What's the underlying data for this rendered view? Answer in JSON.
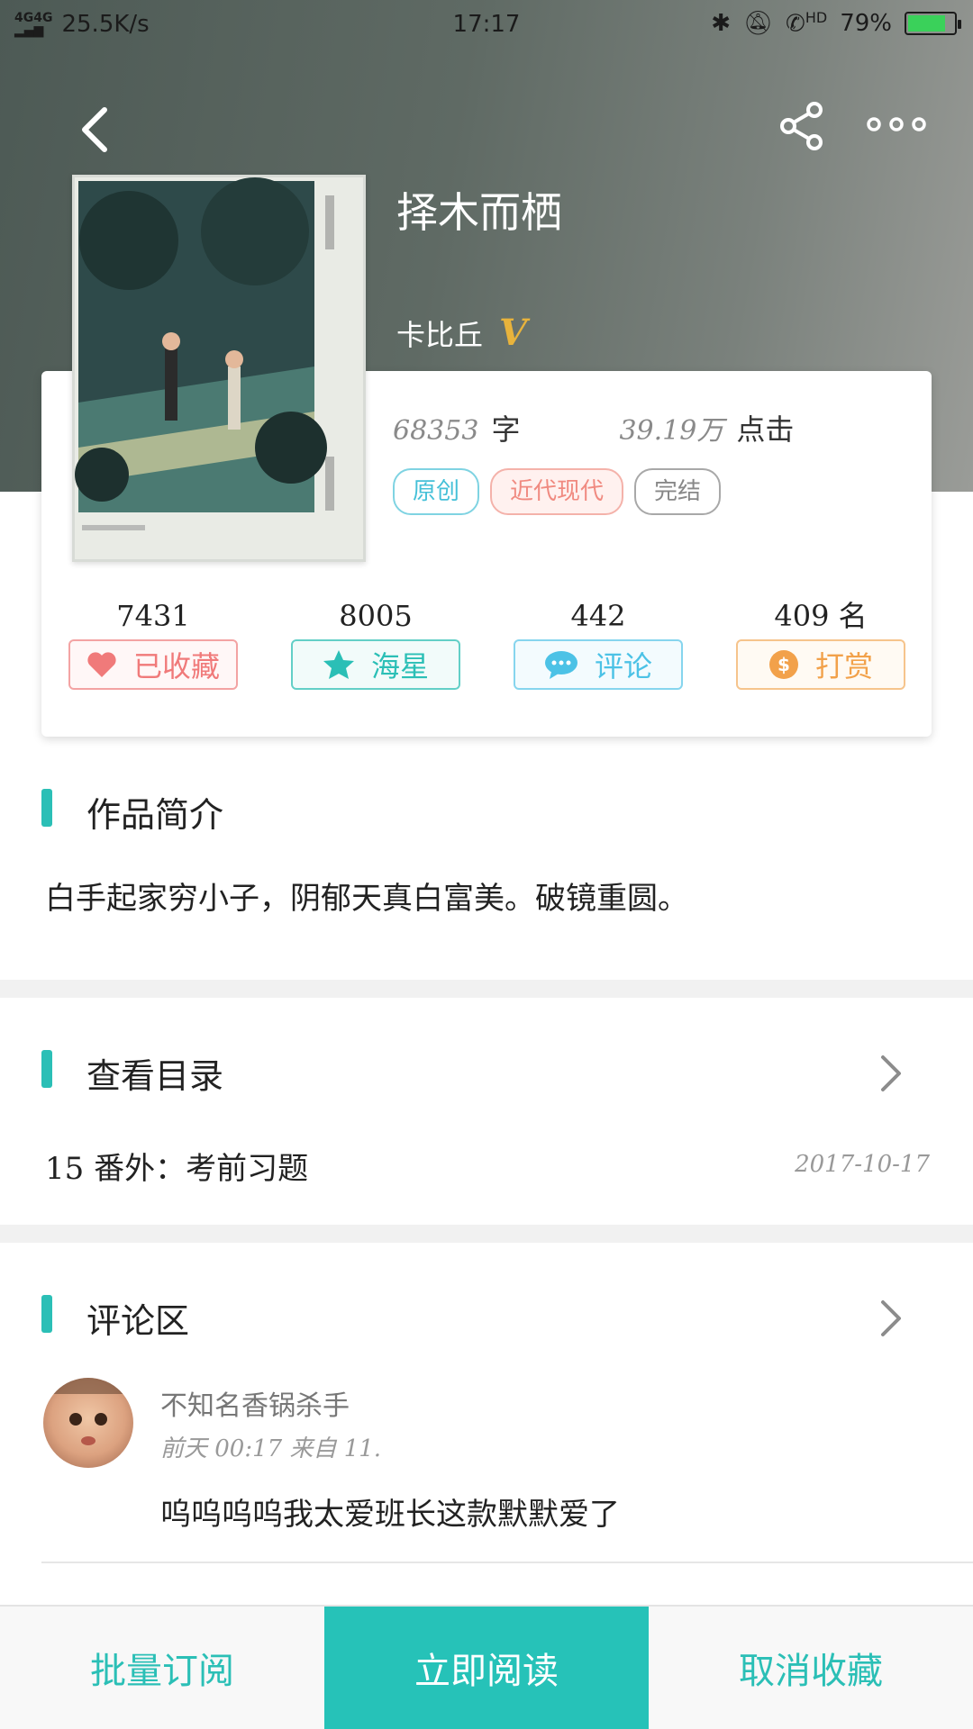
{
  "status_bar": {
    "network": "4G 4G",
    "speed": "25.5K/s",
    "time": "17:17",
    "hd": "HD",
    "battery": "79%"
  },
  "colors": {
    "accent": "#2bbfb6",
    "header_bg": "#5f6a64",
    "tag_original": "#45c0d8",
    "tag_genre": "#f08a80",
    "tag_status": "#888888",
    "btn_favorite": "#f07a7a",
    "btn_star": "#2bbfb6",
    "btn_comment": "#4cc2e6",
    "btn_reward": "#f2a14a"
  },
  "book": {
    "title": "择木而栖",
    "author": "卡比丘",
    "vip_icon": "V",
    "words": "68353",
    "words_unit": "字",
    "clicks": "39.19万",
    "clicks_unit": "点击",
    "tags": [
      "原创",
      "近代现代",
      "完结"
    ]
  },
  "actions": [
    {
      "count": "7431",
      "label": "已收藏",
      "icon": "heart-icon"
    },
    {
      "count": "8005",
      "label": "海星",
      "icon": "star-icon"
    },
    {
      "count": "442",
      "label": "评论",
      "icon": "comment-icon"
    },
    {
      "count": "409 名",
      "label": "打赏",
      "icon": "coin-icon"
    }
  ],
  "intro": {
    "heading": "作品简介",
    "text": "白手起家穷小子，阴郁天真白富美。破镜重圆。"
  },
  "toc": {
    "heading": "查看目录",
    "latest_chapter": "15 番外：考前习题",
    "date": "2017-10-17"
  },
  "comments": {
    "heading": "评论区",
    "items": [
      {
        "user": "不知名香锅杀手",
        "meta": "前天 00:17 来自 11.",
        "text": "呜呜呜呜我太爱班长这款默默爱了"
      }
    ]
  },
  "bottom_bar": {
    "batch": "批量订阅",
    "read": "立即阅读",
    "unfavorite": "取消收藏"
  }
}
